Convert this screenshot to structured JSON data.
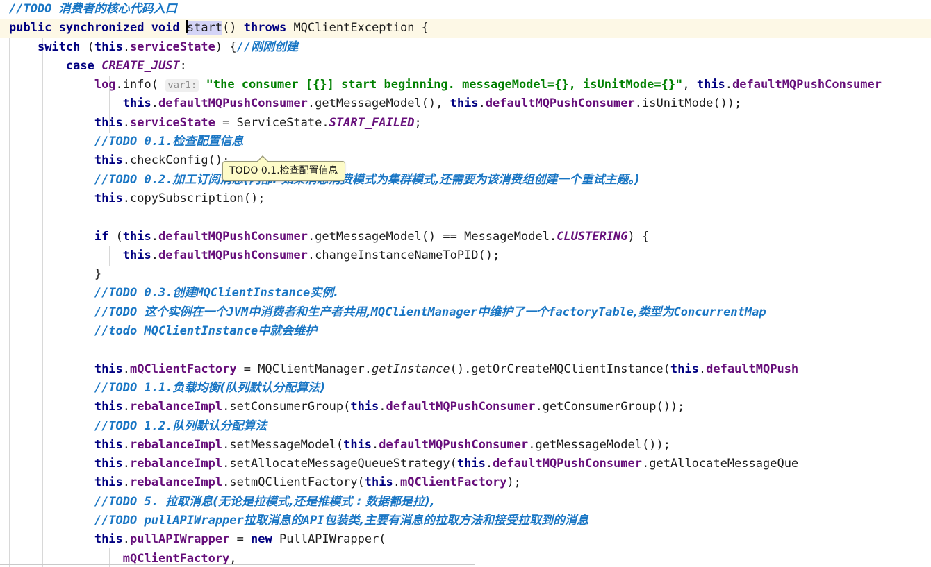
{
  "editor": {
    "language": "java",
    "file_kind": "java-source",
    "colors": {
      "keyword": "#000080",
      "field": "#660e7a",
      "string": "#008000",
      "comment_todo": "#1976c4",
      "plain": "#1c1c1c",
      "caret_line_bg": "#fdf8e6",
      "selection_bg": "#d4d4f7",
      "indent_guide": "#d8d8d8",
      "inlay_hint_bg": "#efefef",
      "tooltip_bg": "#fdfbc8",
      "tooltip_border": "#9a9a7a"
    }
  },
  "tooltip": {
    "text": "TODO 0.1.检查配置信息",
    "visible": true
  },
  "caret": {
    "selected_text": "start",
    "line_index": 1
  },
  "code": {
    "lines": [
      {
        "n": 0,
        "indent": 0,
        "highlighted": false,
        "tokens": [
          {
            "t": "//TODO ",
            "c": "cmt"
          },
          {
            "t": "消费者的核心代码入口",
            "c": "cmt cn"
          }
        ]
      },
      {
        "n": 1,
        "indent": 0,
        "highlighted": true,
        "tokens": [
          {
            "t": "public synchronized void ",
            "c": "kw"
          },
          {
            "t": "start",
            "c": "pln sel",
            "caret_before": true
          },
          {
            "t": "() ",
            "c": "pln"
          },
          {
            "t": "throws ",
            "c": "kw"
          },
          {
            "t": "MQClientException {",
            "c": "pln"
          }
        ]
      },
      {
        "n": 2,
        "indent": 1,
        "highlighted": false,
        "tokens": [
          {
            "t": "switch ",
            "c": "kw"
          },
          {
            "t": "(",
            "c": "pln"
          },
          {
            "t": "this",
            "c": "this"
          },
          {
            "t": ".",
            "c": "pln"
          },
          {
            "t": "serviceState",
            "c": "fld"
          },
          {
            "t": ") {",
            "c": "pln"
          },
          {
            "t": "//",
            "c": "cmt"
          },
          {
            "t": "刚刚创建",
            "c": "cmt cn"
          }
        ]
      },
      {
        "n": 3,
        "indent": 2,
        "highlighted": false,
        "tokens": [
          {
            "t": "case ",
            "c": "kw"
          },
          {
            "t": "CREATE_JUST",
            "c": "stat"
          },
          {
            "t": ":",
            "c": "pln"
          }
        ]
      },
      {
        "n": 4,
        "indent": 3,
        "highlighted": false,
        "tokens": [
          {
            "t": "log",
            "c": "fld"
          },
          {
            "t": ".info( ",
            "c": "pln"
          },
          {
            "t": "var1:",
            "c": "hint"
          },
          {
            "t": " ",
            "c": "pln"
          },
          {
            "t": "\"the consumer [{}] start beginning. messageModel={}, isUnitMode={}\"",
            "c": "str"
          },
          {
            "t": ", ",
            "c": "pln"
          },
          {
            "t": "this",
            "c": "this"
          },
          {
            "t": ".",
            "c": "pln"
          },
          {
            "t": "defaultMQPushConsumer",
            "c": "fld"
          }
        ]
      },
      {
        "n": 5,
        "indent": 4,
        "highlighted": false,
        "tokens": [
          {
            "t": "this",
            "c": "this"
          },
          {
            "t": ".",
            "c": "pln"
          },
          {
            "t": "defaultMQPushConsumer",
            "c": "fld"
          },
          {
            "t": ".getMessageModel(), ",
            "c": "pln"
          },
          {
            "t": "this",
            "c": "this"
          },
          {
            "t": ".",
            "c": "pln"
          },
          {
            "t": "defaultMQPushConsumer",
            "c": "fld"
          },
          {
            "t": ".isUnitMode());",
            "c": "pln"
          }
        ]
      },
      {
        "n": 6,
        "indent": 3,
        "highlighted": false,
        "tokens": [
          {
            "t": "this",
            "c": "this"
          },
          {
            "t": ".",
            "c": "pln"
          },
          {
            "t": "serviceState",
            "c": "fld"
          },
          {
            "t": " = ServiceState.",
            "c": "pln"
          },
          {
            "t": "START_FAILED",
            "c": "stat"
          },
          {
            "t": ";",
            "c": "pln"
          }
        ]
      },
      {
        "n": 7,
        "indent": 3,
        "highlighted": false,
        "tokens": [
          {
            "t": "//TODO 0.1.",
            "c": "cmt"
          },
          {
            "t": "检查配置信息",
            "c": "cmt cn"
          }
        ]
      },
      {
        "n": 8,
        "indent": 3,
        "highlighted": false,
        "tokens": [
          {
            "t": "this",
            "c": "this"
          },
          {
            "t": ".",
            "c": "pln"
          },
          {
            "t": "checkConfig();",
            "c": "pln"
          }
        ]
      },
      {
        "n": 9,
        "indent": 3,
        "highlighted": false,
        "tokens": [
          {
            "t": "//TODO 0.2.",
            "c": "cmt"
          },
          {
            "t": "加工订阅消息(内部: 如果消息消费模式为集群模式,还需要为该消费组创建一个重试主题。)",
            "c": "cmt cn"
          }
        ]
      },
      {
        "n": 10,
        "indent": 3,
        "highlighted": false,
        "tokens": [
          {
            "t": "this",
            "c": "this"
          },
          {
            "t": ".",
            "c": "pln"
          },
          {
            "t": "copySubscription();",
            "c": "pln"
          }
        ]
      },
      {
        "n": 11,
        "indent": 0,
        "highlighted": false,
        "tokens": []
      },
      {
        "n": 12,
        "indent": 3,
        "highlighted": false,
        "tokens": [
          {
            "t": "if ",
            "c": "kw"
          },
          {
            "t": "(",
            "c": "pln"
          },
          {
            "t": "this",
            "c": "this"
          },
          {
            "t": ".",
            "c": "pln"
          },
          {
            "t": "defaultMQPushConsumer",
            "c": "fld"
          },
          {
            "t": ".getMessageModel() == MessageModel.",
            "c": "pln"
          },
          {
            "t": "CLUSTERING",
            "c": "stat"
          },
          {
            "t": ") {",
            "c": "pln"
          }
        ]
      },
      {
        "n": 13,
        "indent": 4,
        "highlighted": false,
        "tokens": [
          {
            "t": "this",
            "c": "this"
          },
          {
            "t": ".",
            "c": "pln"
          },
          {
            "t": "defaultMQPushConsumer",
            "c": "fld"
          },
          {
            "t": ".changeInstanceNameToPID();",
            "c": "pln"
          }
        ]
      },
      {
        "n": 14,
        "indent": 3,
        "highlighted": false,
        "tokens": [
          {
            "t": "}",
            "c": "pln"
          }
        ]
      },
      {
        "n": 15,
        "indent": 3,
        "highlighted": false,
        "tokens": [
          {
            "t": "//TODO 0.3.",
            "c": "cmt"
          },
          {
            "t": "创建",
            "c": "cmt cn"
          },
          {
            "t": "MQClientInstance",
            "c": "cmt"
          },
          {
            "t": "实例.",
            "c": "cmt cn"
          }
        ]
      },
      {
        "n": 16,
        "indent": 3,
        "highlighted": false,
        "tokens": [
          {
            "t": "//TODO ",
            "c": "cmt"
          },
          {
            "t": "这个实例在一个",
            "c": "cmt cn"
          },
          {
            "t": "JVM",
            "c": "cmt"
          },
          {
            "t": "中消费者和生产者共用,",
            "c": "cmt cn"
          },
          {
            "t": "MQClientManager",
            "c": "cmt"
          },
          {
            "t": "中维护了一个",
            "c": "cmt cn"
          },
          {
            "t": "factoryTable",
            "c": "cmt"
          },
          {
            "t": ",类型为",
            "c": "cmt cn"
          },
          {
            "t": "ConcurrentMap",
            "c": "cmt"
          }
        ]
      },
      {
        "n": 17,
        "indent": 3,
        "highlighted": false,
        "tokens": [
          {
            "t": "//todo MQClientInstance",
            "c": "cmt"
          },
          {
            "t": "中就会维护",
            "c": "cmt cn"
          }
        ]
      },
      {
        "n": 18,
        "indent": 0,
        "highlighted": false,
        "tokens": []
      },
      {
        "n": 19,
        "indent": 3,
        "highlighted": false,
        "tokens": [
          {
            "t": "this",
            "c": "this"
          },
          {
            "t": ".",
            "c": "pln"
          },
          {
            "t": "mQClientFactory",
            "c": "fld"
          },
          {
            "t": " = MQClientManager.",
            "c": "pln"
          },
          {
            "t": "getInstance",
            "c": "mthi"
          },
          {
            "t": "().getOrCreateMQClientInstance(",
            "c": "pln"
          },
          {
            "t": "this",
            "c": "this"
          },
          {
            "t": ".",
            "c": "pln"
          },
          {
            "t": "defaultMQPush",
            "c": "fld"
          }
        ]
      },
      {
        "n": 20,
        "indent": 3,
        "highlighted": false,
        "tokens": [
          {
            "t": "//TODO 1.1.",
            "c": "cmt"
          },
          {
            "t": "负载均衡(队列默认分配算法)",
            "c": "cmt cn"
          }
        ]
      },
      {
        "n": 21,
        "indent": 3,
        "highlighted": false,
        "tokens": [
          {
            "t": "this",
            "c": "this"
          },
          {
            "t": ".",
            "c": "pln"
          },
          {
            "t": "rebalanceImpl",
            "c": "fld"
          },
          {
            "t": ".setConsumerGroup(",
            "c": "pln"
          },
          {
            "t": "this",
            "c": "this"
          },
          {
            "t": ".",
            "c": "pln"
          },
          {
            "t": "defaultMQPushConsumer",
            "c": "fld"
          },
          {
            "t": ".getConsumerGroup());",
            "c": "pln"
          }
        ]
      },
      {
        "n": 22,
        "indent": 3,
        "highlighted": false,
        "tokens": [
          {
            "t": "//TODO 1.2.",
            "c": "cmt"
          },
          {
            "t": "队列默认分配算法",
            "c": "cmt cn"
          }
        ]
      },
      {
        "n": 23,
        "indent": 3,
        "highlighted": false,
        "tokens": [
          {
            "t": "this",
            "c": "this"
          },
          {
            "t": ".",
            "c": "pln"
          },
          {
            "t": "rebalanceImpl",
            "c": "fld"
          },
          {
            "t": ".setMessageModel(",
            "c": "pln"
          },
          {
            "t": "this",
            "c": "this"
          },
          {
            "t": ".",
            "c": "pln"
          },
          {
            "t": "defaultMQPushConsumer",
            "c": "fld"
          },
          {
            "t": ".getMessageModel());",
            "c": "pln"
          }
        ]
      },
      {
        "n": 24,
        "indent": 3,
        "highlighted": false,
        "tokens": [
          {
            "t": "this",
            "c": "this"
          },
          {
            "t": ".",
            "c": "pln"
          },
          {
            "t": "rebalanceImpl",
            "c": "fld"
          },
          {
            "t": ".setAllocateMessageQueueStrategy(",
            "c": "pln"
          },
          {
            "t": "this",
            "c": "this"
          },
          {
            "t": ".",
            "c": "pln"
          },
          {
            "t": "defaultMQPushConsumer",
            "c": "fld"
          },
          {
            "t": ".getAllocateMessageQue",
            "c": "pln"
          }
        ]
      },
      {
        "n": 25,
        "indent": 3,
        "highlighted": false,
        "tokens": [
          {
            "t": "this",
            "c": "this"
          },
          {
            "t": ".",
            "c": "pln"
          },
          {
            "t": "rebalanceImpl",
            "c": "fld"
          },
          {
            "t": ".setmQClientFactory(",
            "c": "pln"
          },
          {
            "t": "this",
            "c": "this"
          },
          {
            "t": ".",
            "c": "pln"
          },
          {
            "t": "mQClientFactory",
            "c": "fld"
          },
          {
            "t": ");",
            "c": "pln"
          }
        ]
      },
      {
        "n": 26,
        "indent": 3,
        "highlighted": false,
        "tokens": [
          {
            "t": "//TODO 5. ",
            "c": "cmt"
          },
          {
            "t": "拉取消息(无论是拉模式,还是推模式 : 数据都是拉),",
            "c": "cmt cn"
          }
        ]
      },
      {
        "n": 27,
        "indent": 3,
        "highlighted": false,
        "tokens": [
          {
            "t": "//TODO pullAPIWrapper",
            "c": "cmt"
          },
          {
            "t": "拉取消息的",
            "c": "cmt cn"
          },
          {
            "t": "API",
            "c": "cmt"
          },
          {
            "t": "包装类,主要有消息的拉取方法和接受拉取到的消息",
            "c": "cmt cn"
          }
        ]
      },
      {
        "n": 28,
        "indent": 3,
        "highlighted": false,
        "tokens": [
          {
            "t": "this",
            "c": "this"
          },
          {
            "t": ".",
            "c": "pln"
          },
          {
            "t": "pullAPIWrapper",
            "c": "fld"
          },
          {
            "t": " = ",
            "c": "pln"
          },
          {
            "t": "new ",
            "c": "kw"
          },
          {
            "t": "PullAPIWrapper(",
            "c": "pln"
          }
        ]
      },
      {
        "n": 29,
        "indent": 4,
        "highlighted": false,
        "tokens": [
          {
            "t": "mQClientFactory",
            "c": "fld"
          },
          {
            "t": ",",
            "c": "pln"
          }
        ]
      }
    ]
  }
}
